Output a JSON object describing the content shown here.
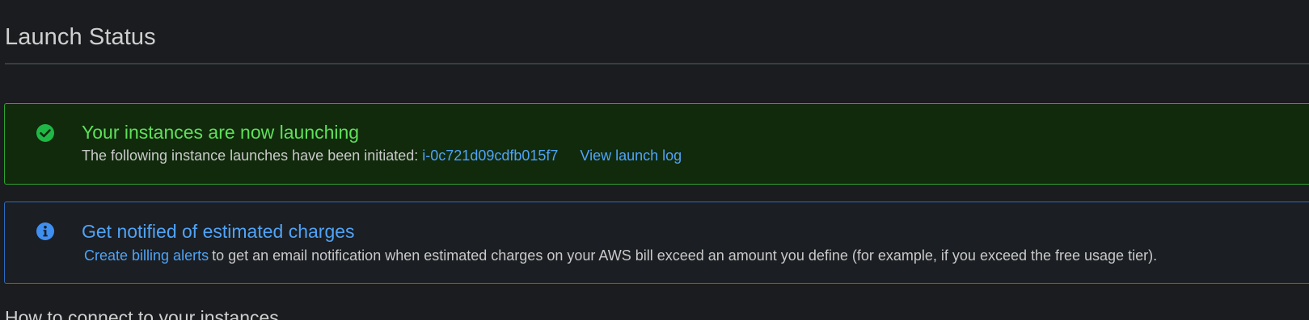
{
  "page": {
    "title": "Launch Status",
    "next_section_title": "How to connect to your instances"
  },
  "success_alert": {
    "icon": "check-circle-icon",
    "heading": "Your instances are now launching",
    "body_text": "The following instance launches have been initiated:",
    "instance_id": "i-0c721d09cdfb015f7",
    "view_log_label": "View launch log",
    "colors": {
      "border": "#2ea52e",
      "heading": "#5fe05a",
      "background": "#112a0c"
    }
  },
  "info_alert": {
    "icon": "info-circle-icon",
    "heading": "Get notified of estimated charges",
    "link_label": "Create billing alerts",
    "body_text": "to get an email notification when estimated charges on your AWS bill exceed an amount you define (for example, if you exceed the free usage tier).",
    "colors": {
      "border": "#2b6cc4",
      "heading": "#4fa3f7"
    }
  }
}
